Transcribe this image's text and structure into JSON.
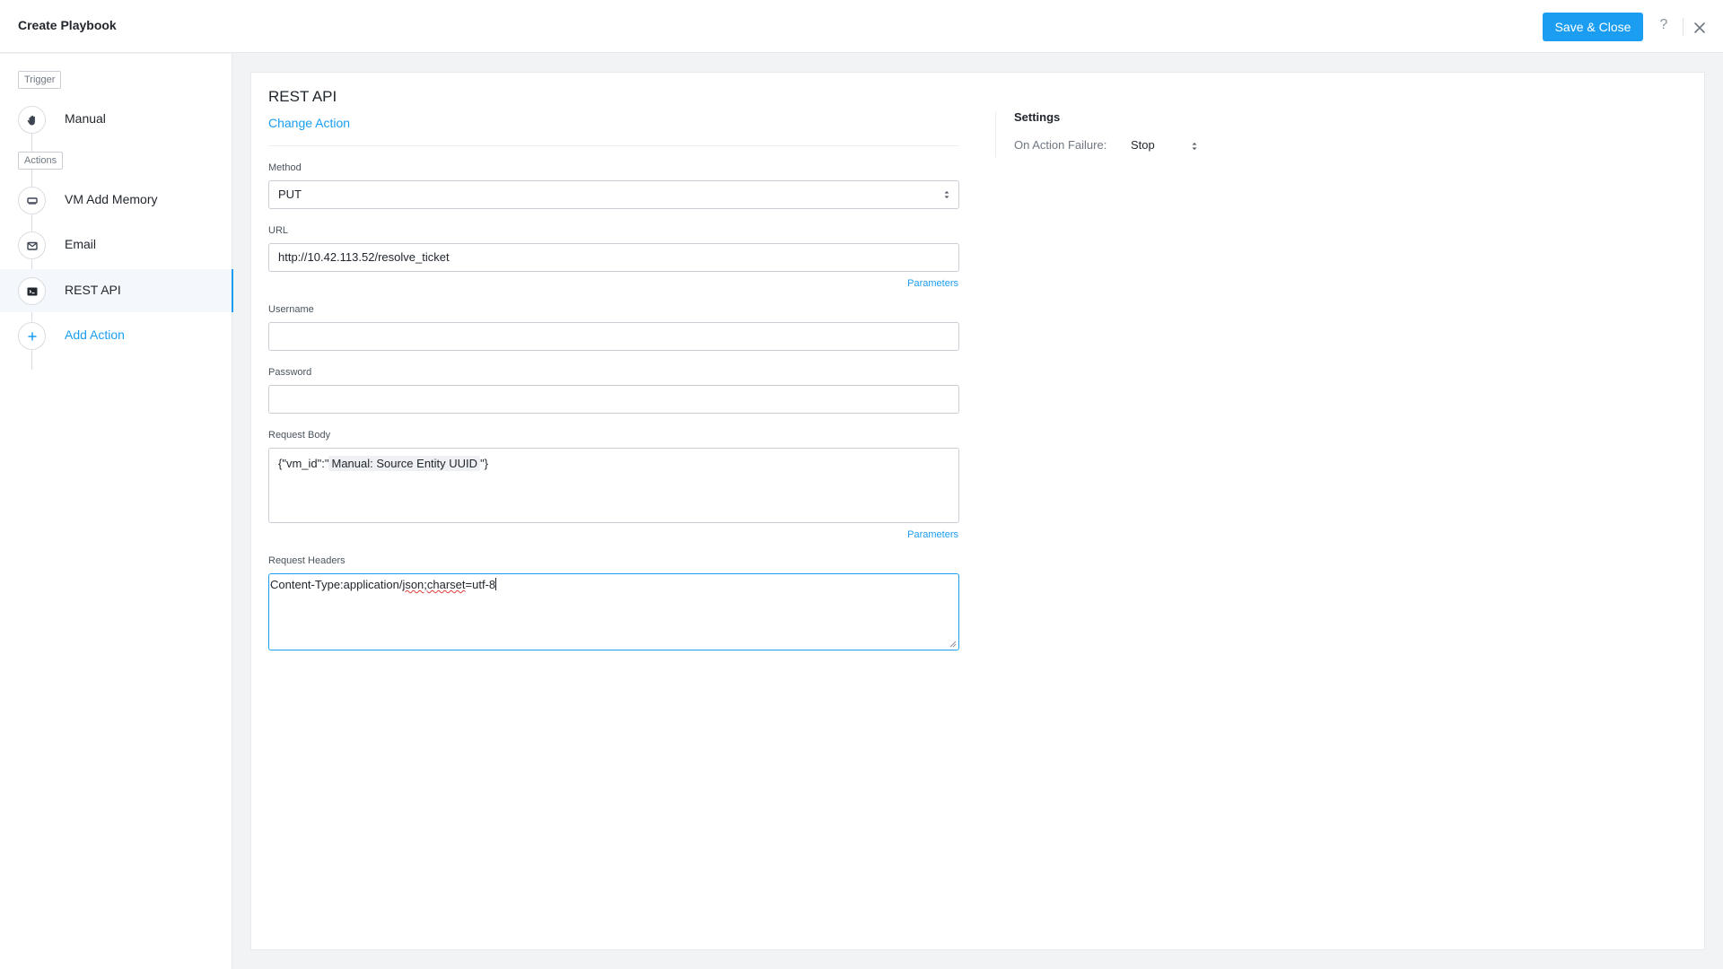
{
  "header": {
    "title": "Create Playbook",
    "save_label": "Save & Close",
    "help_label": "?"
  },
  "sidebar": {
    "trigger_tag": "Trigger",
    "actions_tag": "Actions",
    "steps": [
      {
        "label": "Manual",
        "icon": "hand-icon"
      },
      {
        "label": "VM Add Memory",
        "icon": "memory-icon"
      },
      {
        "label": "Email",
        "icon": "envelope-icon"
      },
      {
        "label": "REST API",
        "icon": "terminal-icon",
        "active": true
      }
    ],
    "add_action_label": "Add Action"
  },
  "form": {
    "action_title": "REST API",
    "change_action_label": "Change Action",
    "method": {
      "label": "Method",
      "value": "PUT"
    },
    "url": {
      "label": "URL",
      "value": "http://10.42.113.52/resolve_ticket",
      "parameters_label": "Parameters"
    },
    "username": {
      "label": "Username",
      "value": ""
    },
    "password": {
      "label": "Password",
      "value": ""
    },
    "request_body": {
      "label": "Request Body",
      "prefix": "{\"vm_id\":\"",
      "token": "Manual: Source Entity UUID",
      "suffix": "\"}",
      "parameters_label": "Parameters"
    },
    "request_headers": {
      "label": "Request Headers",
      "value_prefix": "Content-Type:application/",
      "value_spell": "json;charset",
      "value_suffix": "=utf-8"
    }
  },
  "settings": {
    "title": "Settings",
    "on_failure_label": "On Action Failure:",
    "on_failure_value": "Stop"
  },
  "colors": {
    "accent": "#1b9ef2",
    "text": "#22272e",
    "background": "#f2f3f5"
  }
}
